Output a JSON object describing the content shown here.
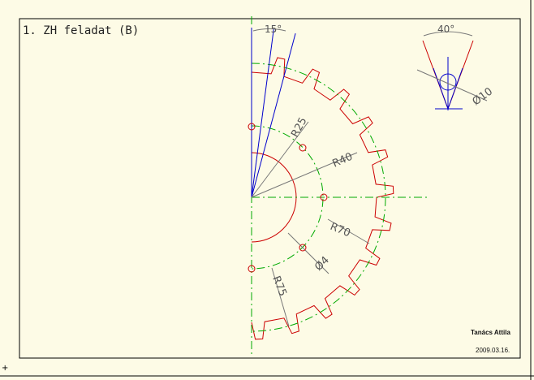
{
  "title": "1. ZH feladat (B)",
  "author": "Tanács Attila",
  "date": "2009.03.16.",
  "dimensions": {
    "angle_pitch": "15°",
    "radius_r25": "R25",
    "radius_r40": "R40",
    "radius_r70": "R70",
    "radius_r75": "R75",
    "hole_dia": "Ø4",
    "detail_angle": "40°",
    "detail_dia": "Ø10"
  },
  "colors": {
    "background": "#fdfbe6",
    "border": "#000000",
    "geometry_red": "#cc0000",
    "center_green": "#00aa00",
    "construction_blue": "#0000cc",
    "dimension_gray": "#666666"
  }
}
